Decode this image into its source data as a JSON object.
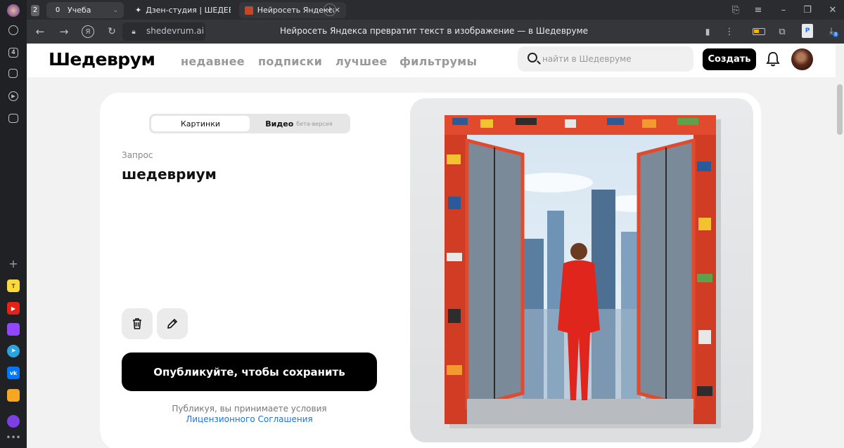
{
  "browser": {
    "tabs": [
      {
        "count": "2",
        "label": ""
      },
      {
        "count": "0",
        "label": "Учеба"
      },
      {
        "label": "Дзен-студия | ШЕДЕВРИ"
      },
      {
        "label": "Нейросеть Яндекса пр"
      }
    ],
    "url": "shedevrum.ai",
    "page_title": "Нейросеть Яндекса превратит текст в изображение — в Шедевруме",
    "rail_badge": "4",
    "download_badge": "8"
  },
  "header": {
    "logo": "Шедеврум",
    "nav": [
      "недавнее",
      "подписки",
      "лучшее",
      "фильтрумы"
    ],
    "search_placeholder": "найти в Шедевруме",
    "create_label": "Создать"
  },
  "editor": {
    "tabs": {
      "images": "Картинки",
      "video": "Видео",
      "video_badge": "бета-версия"
    },
    "request_label": "Запрос",
    "request_text": "шедевриум",
    "publish_label": "Опубликуйте, чтобы сохранить",
    "terms_text": "Публикуя, вы принимаете условия",
    "terms_link": "Лицензионного Соглашения"
  },
  "colors": {
    "accent": "#e4562a",
    "link": "#1a73e8"
  }
}
